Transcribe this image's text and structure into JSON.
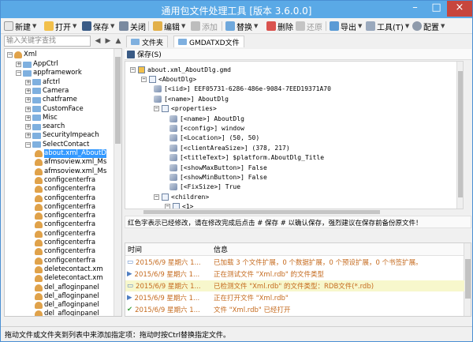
{
  "window": {
    "title": "通用包文件处理工具 [版本 3.6.0.0]"
  },
  "toolbar": {
    "new": "新建",
    "open": "打开",
    "save": "保存",
    "close": "关闭",
    "edit": "编辑",
    "add": "添加",
    "replace": "替换",
    "delete": "删除",
    "restore": "还原",
    "export": "导出",
    "tools": "工具(T)",
    "config": "配置"
  },
  "search": {
    "placeholder": "输入关键字查找"
  },
  "tabs": [
    {
      "label": "文件夹"
    },
    {
      "label": "GMDATXD文件"
    }
  ],
  "editor": {
    "save_label": "保存(S)"
  },
  "tree": {
    "root": "Xml",
    "items": [
      {
        "label": "AppCtrl",
        "type": "folder"
      },
      {
        "label": "appframework",
        "type": "folder"
      },
      {
        "label": "afctrl",
        "type": "folder"
      },
      {
        "label": "Camera",
        "type": "folder"
      },
      {
        "label": "chatframe",
        "type": "folder"
      },
      {
        "label": "CustomFace",
        "type": "folder"
      },
      {
        "label": "Misc",
        "type": "folder"
      },
      {
        "label": "search",
        "type": "folder"
      },
      {
        "label": "SecurityImpeach",
        "type": "folder"
      },
      {
        "label": "SelectContact",
        "type": "folder"
      },
      {
        "label": "about.xml_AboutD",
        "type": "file",
        "selected": true
      },
      {
        "label": "afmsoview.xml_Ms",
        "type": "file"
      },
      {
        "label": "afmsoview.xml_Ms",
        "type": "file"
      },
      {
        "label": "configcenterfra",
        "type": "file"
      },
      {
        "label": "configcenterfra",
        "type": "file"
      },
      {
        "label": "configcenterfra",
        "type": "file"
      },
      {
        "label": "configcenterfra",
        "type": "file"
      },
      {
        "label": "configcenterfra",
        "type": "file"
      },
      {
        "label": "configcenterfra",
        "type": "file"
      },
      {
        "label": "configcenterfra",
        "type": "file"
      },
      {
        "label": "configcenterfra",
        "type": "file"
      },
      {
        "label": "configcenterfra",
        "type": "file"
      },
      {
        "label": "configcenterfra",
        "type": "file"
      },
      {
        "label": "deletecontact.xm",
        "type": "file"
      },
      {
        "label": "deletecontact.xm",
        "type": "file"
      },
      {
        "label": "del_afloginpanel",
        "type": "file"
      },
      {
        "label": "del_afloginpanel",
        "type": "file"
      },
      {
        "label": "del_afloginpanel",
        "type": "file"
      },
      {
        "label": "del_afloginpanel",
        "type": "file"
      }
    ]
  },
  "xml": {
    "rows": [
      {
        "text": "about.xml_AboutDlg.gmd"
      },
      {
        "text": "<AboutDlg>"
      },
      {
        "text": "[<iid>]   EEF05731-6286-486e-9084-7EED19371A70"
      },
      {
        "text": "[<name>]   AboutDlg"
      },
      {
        "text": "<properties>"
      },
      {
        "text": "[<name>]   AboutDlg"
      },
      {
        "text": "[<config>]   window"
      },
      {
        "text": "[<Location>]   (50, 50)"
      },
      {
        "text": "[<clientAreaSize>]   (378, 217)"
      },
      {
        "text": "[<titleText>]   $platform.AboutDlg_Title"
      },
      {
        "text": "[<showMaxButton>]   False"
      },
      {
        "text": "[<showMinButton>]   False"
      },
      {
        "text": "[<FixSize>]   True"
      },
      {
        "text": "<children>"
      },
      {
        "text": "<1>"
      }
    ]
  },
  "hint": {
    "text": "红色字表示已经修改，请在修改完成后点击 # 保存 # 以确认保存，强烈建议在保存前备份原文件！"
  },
  "log": {
    "columns": [
      "时间",
      "信息"
    ],
    "rows": [
      {
        "time": "2015/6/9 星期六 1...",
        "info": "已加载 3 个文件扩展，0 个数据扩展，0 个预设扩展，0 个书签扩展。",
        "icon": "monitor"
      },
      {
        "time": "2015/6/9 星期六 1...",
        "info": "正在测试文件 \"Xml.rdb\" 的文件类型",
        "icon": "play"
      },
      {
        "time": "2015/6/9 星期六 1...",
        "info": "已检测文件 \"Xml.rdb\" 的文件类型：RDB文件(*.rdb)",
        "icon": "monitor"
      },
      {
        "time": "2015/6/9 星期六 1...",
        "info": "正在打开文件 \"Xml.rdb\"",
        "icon": "play"
      },
      {
        "time": "2015/6/9 星期六 1...",
        "info": "文件 \"Xml.rdb\" 已经打开",
        "icon": "check"
      }
    ]
  },
  "status": {
    "text": "拖动文件或文件夹到列表中来添加指定项：拖动时按Ctrl替换指定文件。"
  },
  "colors": {
    "titlebar": "#5aa9e6",
    "selection": "#3399ff",
    "log_text": "#c56b1f"
  }
}
